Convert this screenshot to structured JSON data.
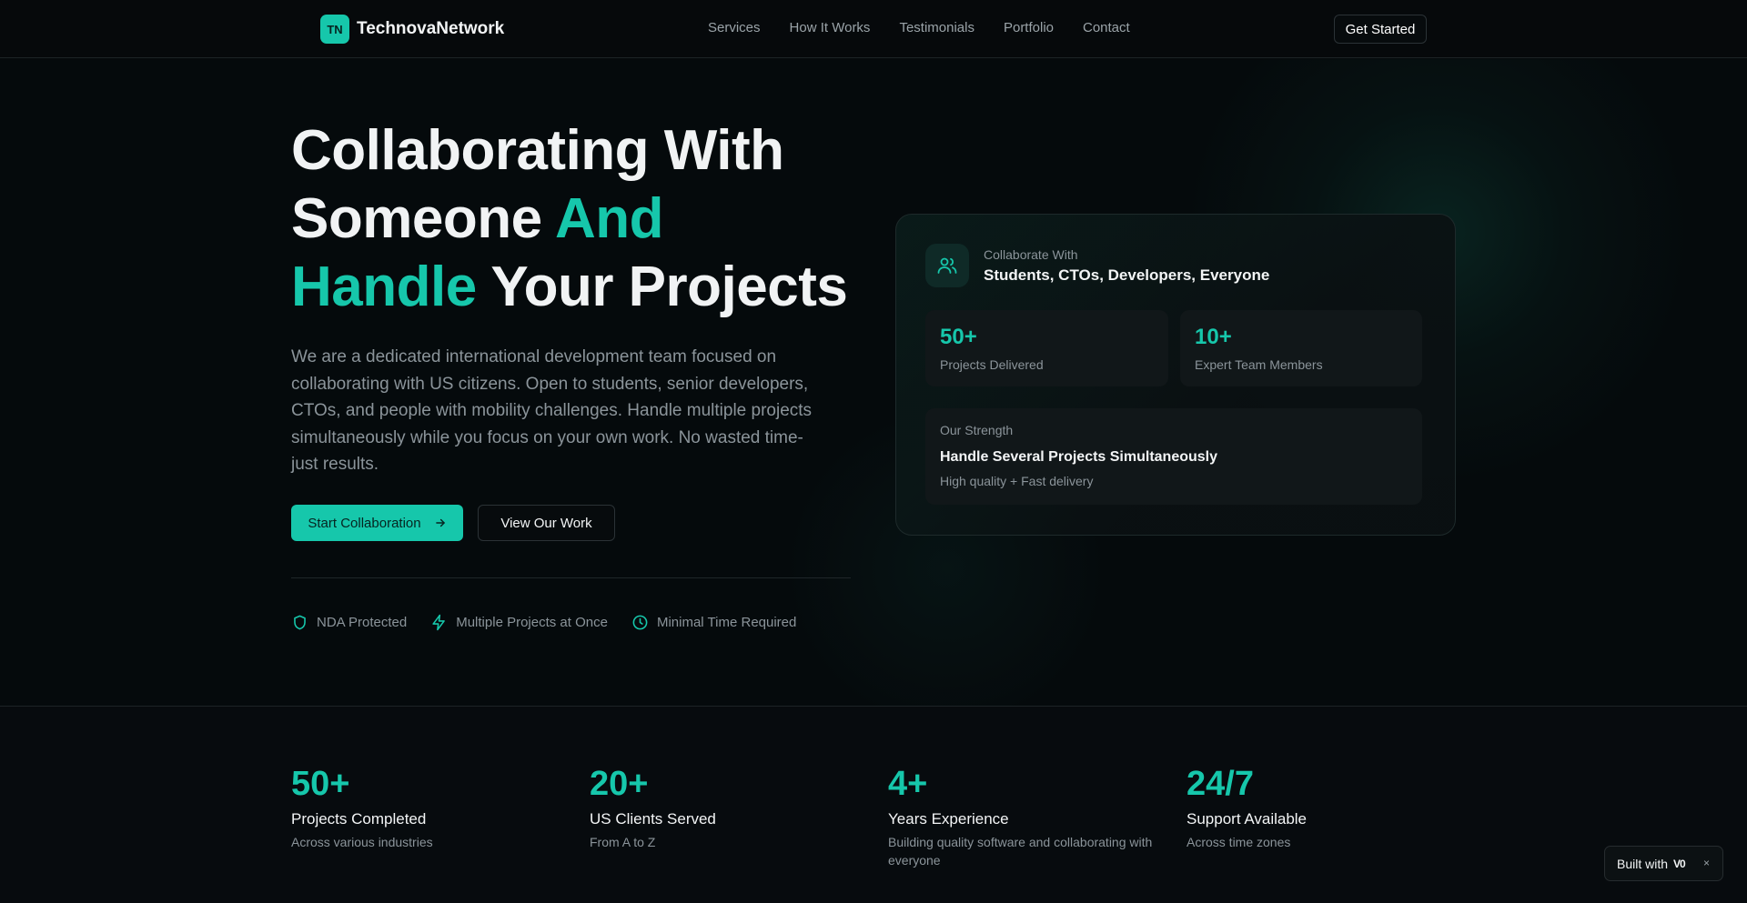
{
  "nav": {
    "logo_badge": "TN",
    "logo_text": "TechnovaNetwork",
    "links": [
      "Services",
      "How It Works",
      "Testimonials",
      "Portfolio",
      "Contact"
    ],
    "cta": "Get Started"
  },
  "hero": {
    "title_line1": "Collaborating With",
    "title_line2a": "Someone ",
    "title_line2b": "And",
    "title_line3a": "Handle",
    "title_line3b": " Your Projects",
    "description": "We are a dedicated international development team focused on collaborating with US citizens. Open to students, senior developers, CTOs, and people with mobility challenges. Handle multiple projects simultaneously while you focus on your own work. No wasted time-just results.",
    "primary_button": "Start Collaboration",
    "secondary_button": "View Our Work",
    "trust": [
      {
        "icon": "shield-icon",
        "label": "NDA Protected"
      },
      {
        "icon": "lightning-icon",
        "label": "Multiple Projects at Once"
      },
      {
        "icon": "clock-icon",
        "label": "Minimal Time Required"
      }
    ]
  },
  "card": {
    "icon": "users-icon",
    "eyebrow": "Collaborate With",
    "title": "Students, CTOs, Developers, Everyone",
    "stats": [
      {
        "value": "50+",
        "label": "Projects Delivered"
      },
      {
        "value": "10+",
        "label": "Expert Team Members"
      }
    ],
    "strength": {
      "eyebrow": "Our Strength",
      "title": "Handle Several Projects Simultaneously",
      "subtitle": "High quality + Fast delivery"
    }
  },
  "stats": [
    {
      "value": "50+",
      "label": "Projects Completed",
      "desc": "Across various industries"
    },
    {
      "value": "20+",
      "label": "US Clients Served",
      "desc": "From A to Z"
    },
    {
      "value": "4+",
      "label": "Years Experience",
      "desc": "Building quality software and collaborating with everyone"
    },
    {
      "value": "24/7",
      "label": "Support Available",
      "desc": "Across time zones"
    }
  ],
  "badge": {
    "text": "Built with",
    "mark": "V0",
    "close": "×"
  },
  "colors": {
    "accent": "#16c7ab",
    "background": "#050a0c",
    "muted_text": "#8b949a"
  }
}
